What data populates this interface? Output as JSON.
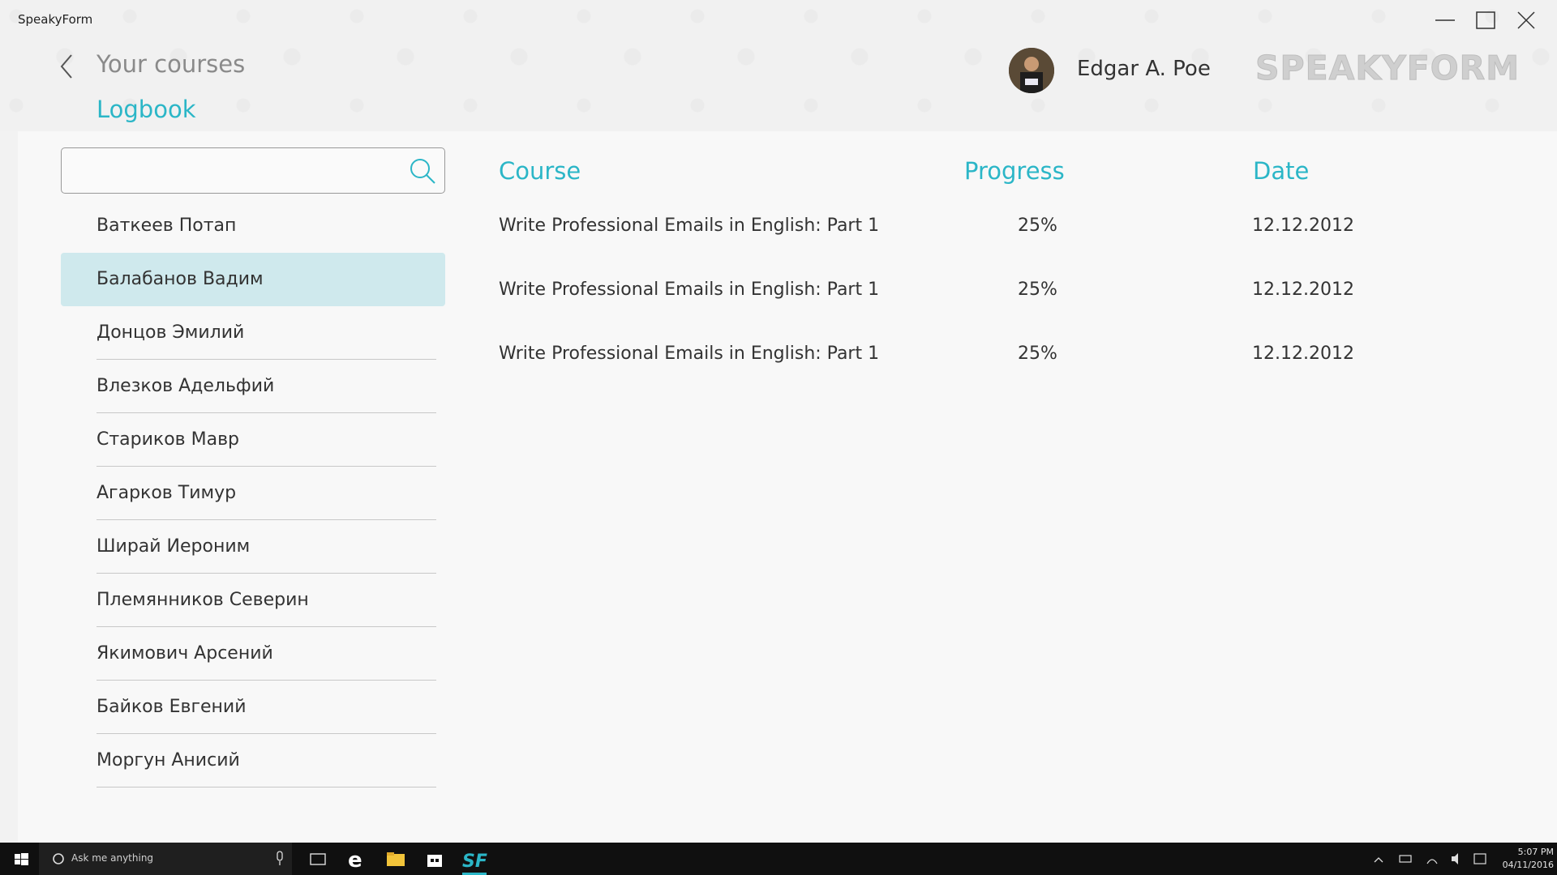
{
  "window": {
    "title": "SpeakyForm"
  },
  "header": {
    "back_label": "Your courses",
    "section_title": "Logbook",
    "user_name": "Edgar A. Poe",
    "logo_text": "SPEAKYFORM"
  },
  "search": {
    "placeholder": "",
    "value": ""
  },
  "students": [
    "Ваткеев Потап",
    "Балабанов Вадим",
    "Донцов Эмилий",
    "Влезков Адельфий",
    "Стариков Мавр",
    "Агарков Тимур",
    "Ширай Иероним",
    "Племянников Северин",
    "Якимович Арсений",
    "Байков Евгений",
    "Моргун Анисий"
  ],
  "selected_student_index": 1,
  "table": {
    "headers": {
      "course": "Course",
      "progress": "Progress",
      "date": "Date"
    },
    "rows": [
      {
        "course": "Write Professional Emails in English: Part 1",
        "progress": "25%",
        "date": "12.12.2012"
      },
      {
        "course": "Write Professional Emails in English: Part 1",
        "progress": "25%",
        "date": "12.12.2012"
      },
      {
        "course": "Write Professional Emails in English: Part 1",
        "progress": "25%",
        "date": "12.12.2012"
      }
    ]
  },
  "taskbar": {
    "search_text": "Ask me anything",
    "time": "5:07 PM",
    "date": "04/11/2016"
  },
  "colors": {
    "accent": "#2bb6c7",
    "selected_bg": "#cfe9ed"
  }
}
